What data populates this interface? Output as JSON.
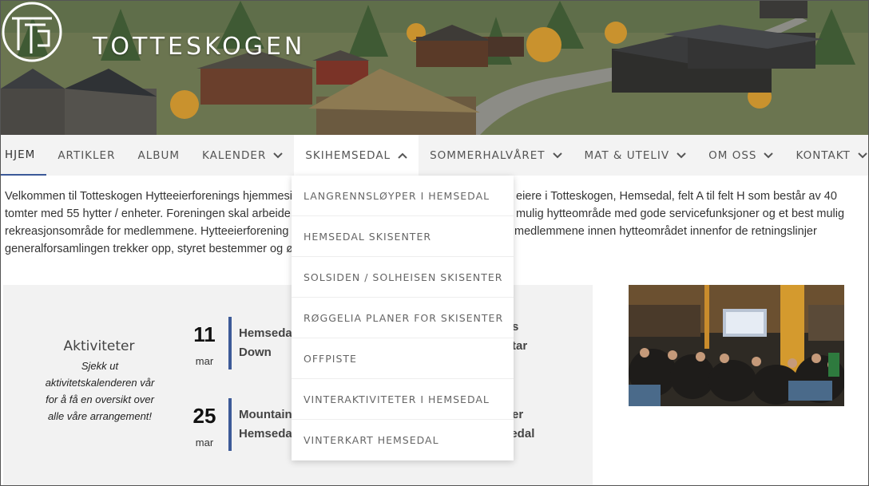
{
  "header": {
    "site_title": "TOTTESKOGEN"
  },
  "nav": {
    "items": [
      {
        "label": "HJEM",
        "dropdown": false,
        "active": true
      },
      {
        "label": "ARTIKLER",
        "dropdown": false
      },
      {
        "label": "ALBUM",
        "dropdown": false
      },
      {
        "label": "KALENDER",
        "dropdown": true
      },
      {
        "label": "SKIHEMSEDAL",
        "dropdown": true,
        "open": true
      },
      {
        "label": "SOMMERHALVÅRET",
        "dropdown": true
      },
      {
        "label": "MAT & UTELIV",
        "dropdown": true
      },
      {
        "label": "OM OSS",
        "dropdown": true
      },
      {
        "label": "KONTAKT",
        "dropdown": true
      }
    ]
  },
  "dropdown": {
    "items": [
      "LANGRENNSLØYPER I HEMSEDAL",
      "HEMSEDAL SKISENTER",
      "SOLSIDEN / SOLHEISEN SKISENTER",
      "RØGGELIA PLANER FOR SKISENTER",
      "OFFPISTE",
      "VINTERAKTIVITETER I HEMSEDAL",
      "VINTERKART HEMSEDAL"
    ]
  },
  "intro": {
    "line1_left": "Velkommen til Totteskogen Hytteeierforenings hjemmesi",
    "line1_right": "eiere i Totteskogen, Hemsedal, felt A til felt H som består av 40",
    "line2_left": "tomter med 55 hytter / enheter.  Foreningen skal arbeide",
    "line2_right": "mulig hytteområde med gode servicefunksjoner og et best mulig",
    "line3_left": "rekreasjonsområde for medlemmene.  Hytteeierforening",
    "line3_right": "medlemmene innen hytteområdet innenfor de retningslinjer",
    "line4_left": "generalforsamlingen trekker opp, styret bestemmer og ø"
  },
  "activities": {
    "title": "Aktiviteter",
    "subtitle": "Sjekk ut aktivitetskalenderen vår for å få en oversikt over alle våre arrangement!",
    "events": [
      {
        "day": "11",
        "month": "mar",
        "title_line1": "Hemseda",
        "title_line2": "Down",
        "right_line1": "s",
        "right_line2": "tar"
      },
      {
        "day": "25",
        "month": "mar",
        "title_line1": "Mountain",
        "title_line2": "Hemseda",
        "right_line1": "er",
        "right_line2": "sedal"
      }
    ]
  }
}
